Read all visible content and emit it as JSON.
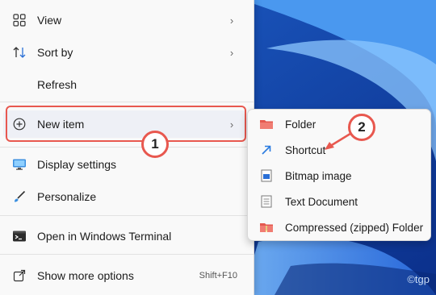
{
  "menu": {
    "items": [
      {
        "label": "View",
        "icon": "grid-icon",
        "has_submenu": true
      },
      {
        "label": "Sort by",
        "icon": "sort-arrows-icon",
        "has_submenu": true
      },
      {
        "label": "Refresh",
        "icon": "",
        "has_submenu": false
      },
      {
        "label": "New item",
        "icon": "plus-circle-icon",
        "has_submenu": true
      },
      {
        "label": "Display settings",
        "icon": "monitor-icon",
        "has_submenu": false
      },
      {
        "label": "Personalize",
        "icon": "brush-icon",
        "has_submenu": false
      },
      {
        "label": "Open in Windows Terminal",
        "icon": "terminal-icon",
        "has_submenu": false
      },
      {
        "label": "Show more options",
        "icon": "external-icon",
        "shortcut": "Shift+F10"
      }
    ]
  },
  "submenu": {
    "items": [
      {
        "label": "Folder",
        "icon": "folder-icon"
      },
      {
        "label": "Shortcut",
        "icon": "shortcut-arrow-icon"
      },
      {
        "label": "Bitmap image",
        "icon": "bitmap-icon"
      },
      {
        "label": "Text Document",
        "icon": "text-document-icon"
      },
      {
        "label": "Compressed (zipped) Folder",
        "icon": "zip-folder-icon"
      }
    ]
  },
  "callouts": {
    "one": "1",
    "two": "2"
  },
  "watermark": "©tgp",
  "colors": {
    "accent_red": "#e8584f",
    "menu_bg": "#f9f9f9",
    "desktop_blue": "#2f7de0"
  }
}
